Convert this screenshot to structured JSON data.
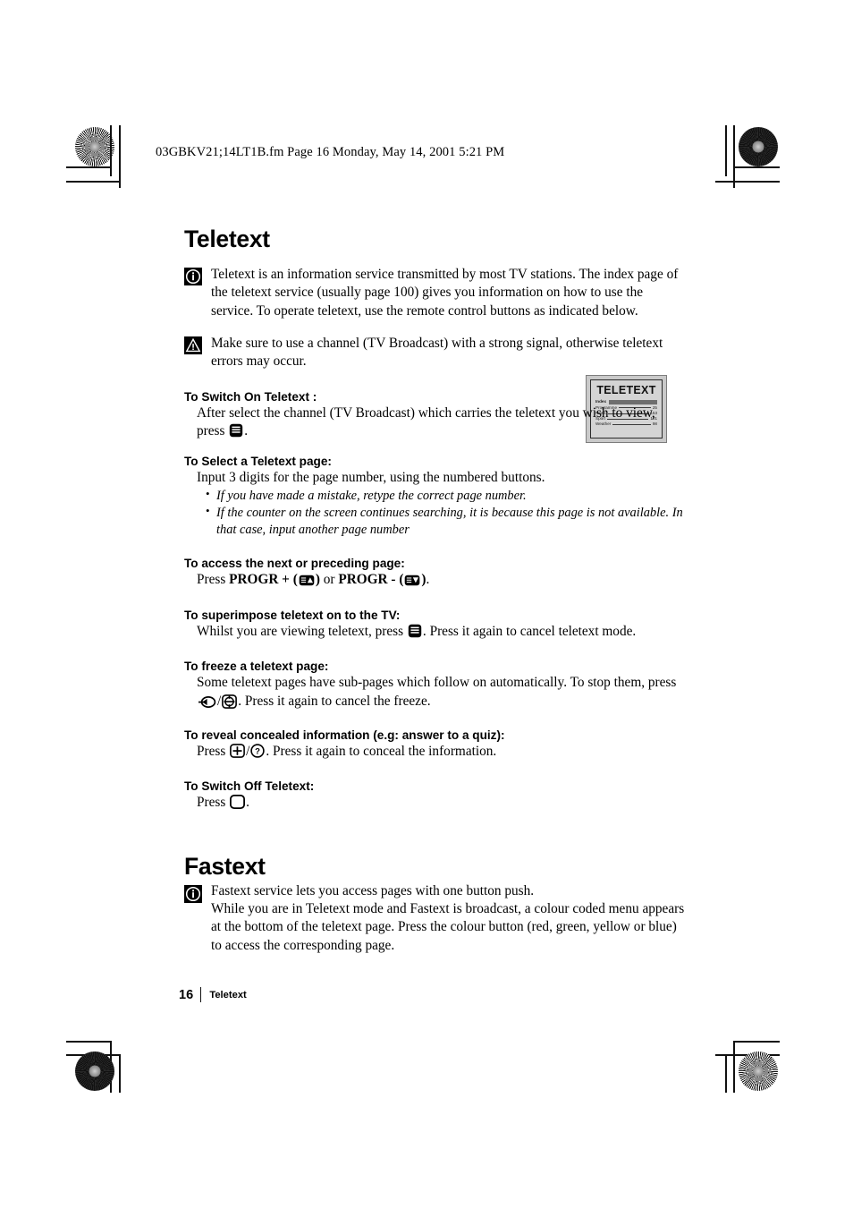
{
  "page_header": "03GBKV21;14LT1B.fm  Page 16  Monday, May 14, 2001  5:21 PM",
  "sections": {
    "teletext": {
      "title": "Teletext",
      "info_note": "Teletext is an information service transmitted by most TV stations. The index page of the teletext service (usually page 100) gives you information on how to use the service. To operate teletext, use the remote control buttons as indicated below.",
      "warning_note": "Make sure to use a channel (TV Broadcast) with a strong signal, otherwise teletext errors may occur.",
      "blocks": [
        {
          "heading": "To Switch On Teletext :",
          "body_prefix": "After select the channel (TV Broadcast) which carries the teletext you wish to view, press",
          "body_suffix": "."
        },
        {
          "heading": "To Select a Teletext page:",
          "body_prefix": "Input 3 digits for the page number, using the numbered buttons.",
          "bullets": [
            "If you have made a mistake, retype the correct page number.",
            "If the counter on the screen continues searching, it is because this page is not available. In that case, input another page number"
          ]
        },
        {
          "heading": "To access the next or preceding page:",
          "press_label": "Press",
          "progr_plus": "PROGR +",
          "joiner": "or",
          "progr_minus": "PROGR -",
          "body_suffix": "."
        },
        {
          "heading": "To superimpose teletext on to the TV:",
          "body_prefix": "Whilst you are viewing teletext, press",
          "body_suffix": ". Press it again to cancel teletext mode."
        },
        {
          "heading": "To freeze a teletext page:",
          "body_prefix": "Some teletext pages have sub-pages which follow on automatically. To stop them, press",
          "separator": "/",
          "body_suffix": ". Press it again to cancel the freeze."
        },
        {
          "heading": "To reveal concealed information (e.g: answer to a quiz):",
          "press_label": "Press",
          "separator": "/",
          "body_suffix": ". Press it again to conceal the information."
        },
        {
          "heading": "To Switch Off Teletext:",
          "press_label": "Press",
          "body_suffix": "."
        }
      ]
    },
    "fastext": {
      "title": "Fastext",
      "line1": "Fastext service lets you access pages with one button push.",
      "line2": "While you are in Teletext mode and Fastext is broadcast, a colour coded menu appears at the bottom of the teletext page. Press the colour button (red, green, yellow or blue) to access the corresponding page."
    }
  },
  "teletext_screen": {
    "title": "TELETEXT",
    "rows": [
      {
        "label": "Index",
        "value": ""
      },
      {
        "label": "Programme",
        "value": "25"
      },
      {
        "label": "News",
        "value": "153"
      },
      {
        "label": "Sport",
        "value": "101"
      },
      {
        "label": "Weather",
        "value": "98"
      }
    ]
  },
  "footer": {
    "page_number": "16",
    "section_name": "Teletext"
  },
  "colors": {
    "text": "#000000",
    "registration": "#8a8a8a",
    "screen_frame": "#c9c9c9",
    "screen_face": "#d4d4d4"
  }
}
